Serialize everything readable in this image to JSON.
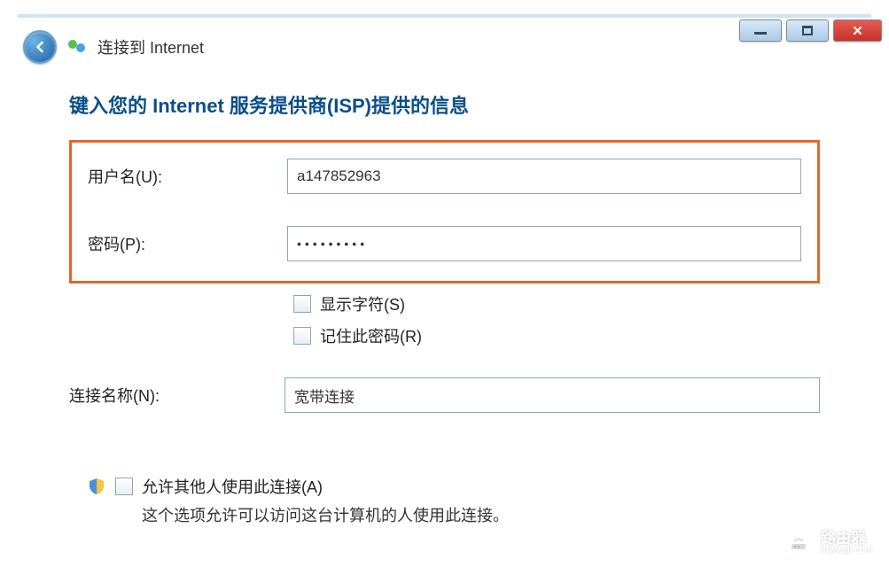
{
  "window": {
    "title": "连接到 Internet"
  },
  "heading": "键入您的 Internet 服务提供商(ISP)提供的信息",
  "fields": {
    "username_label": "用户名(U):",
    "username_value": "a147852963",
    "password_label": "密码(P):",
    "password_value": "•••••••••",
    "show_chars_label": "显示字符(S)",
    "remember_pw_label": "记住此密码(R)",
    "connection_name_label": "连接名称(N):",
    "connection_name_value": "宽带连接"
  },
  "allow": {
    "label": "允许其他人使用此连接(A)",
    "note": "这个选项允许可以访问这台计算机的人使用此连接。"
  },
  "watermark": {
    "name": "路由器",
    "url": "luyouqi.com"
  }
}
